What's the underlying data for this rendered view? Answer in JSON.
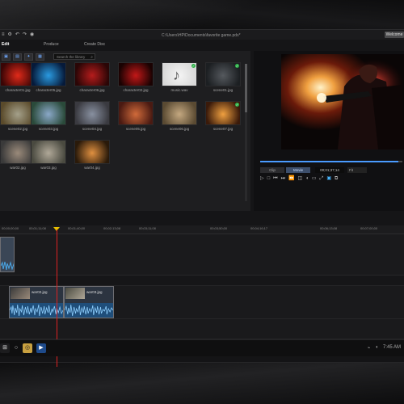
{
  "window": {
    "title_path": "C:\\Users\\HP\\Documents\\favorite game.pds*",
    "welcome_label": "Welcome"
  },
  "mode_tabs": [
    {
      "label": "Edit"
    },
    {
      "label": "Produce"
    },
    {
      "label": "Create Disc"
    }
  ],
  "library": {
    "search_placeholder": "Search the library",
    "items": [
      {
        "caption": "character01.jpg",
        "colors": [
          "#3a0505",
          "#e02a1a"
        ]
      },
      {
        "caption": "character05.jpg",
        "colors": [
          "#061a3a",
          "#2a9ae0"
        ]
      },
      {
        "caption": "character06.jpg",
        "colors": [
          "#2a0606",
          "#b51c1c"
        ]
      },
      {
        "caption": "character02.jpg",
        "colors": [
          "#1a0202",
          "#c21818"
        ]
      },
      {
        "caption": "music.wav",
        "colors": [
          "#d8d8d8",
          "#f4f4f4"
        ],
        "checked": true
      },
      {
        "caption": "scene01.jpg",
        "colors": [
          "#1c1f22",
          "#55595e"
        ],
        "checked": true
      },
      {
        "caption": "scene02.jpg",
        "colors": [
          "#5a4a2a",
          "#a4a08a"
        ]
      },
      {
        "caption": "scene03.jpg",
        "colors": [
          "#2a4a3a",
          "#8aa8c8"
        ]
      },
      {
        "caption": "scene04.jpg",
        "colors": [
          "#3a3a40",
          "#8890a0"
        ]
      },
      {
        "caption": "scene05.jpg",
        "colors": [
          "#4a1a12",
          "#d06a3a"
        ]
      },
      {
        "caption": "scene06.jpg",
        "colors": [
          "#5a4a32",
          "#c4a880"
        ]
      },
      {
        "caption": "scene07.jpg",
        "colors": [
          "#3a1a0a",
          "#f0a040"
        ],
        "checked": true
      },
      {
        "caption": "war02.jpg",
        "colors": [
          "#3a3a3a",
          "#9a8a7a"
        ]
      },
      {
        "caption": "war03.jpg",
        "colors": [
          "#4a4a40",
          "#b0a898"
        ]
      },
      {
        "caption": "war04.jpg",
        "colors": [
          "#2a1a0a",
          "#e09040"
        ]
      }
    ]
  },
  "preview": {
    "mode_clip": "Clip",
    "mode_movie": "Movie",
    "timecode": "00;01;37;14",
    "zoom": "Fit",
    "progress": 0.97
  },
  "timeline": {
    "ruler_labels": [
      "00;00;00;00",
      "00;01;11;08",
      "00;01;40;00",
      "00;02;13;08",
      "00;03;11;08",
      "00;03;50;00",
      "00;04;16;17",
      "00;06;13;08",
      "00;07;00;00"
    ],
    "clips": [
      {
        "label": "war02.jpg"
      },
      {
        "label": "war03.jpg"
      }
    ]
  },
  "taskbar": {
    "icons": [
      "windows-icon",
      "search-icon",
      "task-view-icon",
      "chrome-icon",
      "director-icon"
    ],
    "tray_time": "7:45 AM"
  }
}
